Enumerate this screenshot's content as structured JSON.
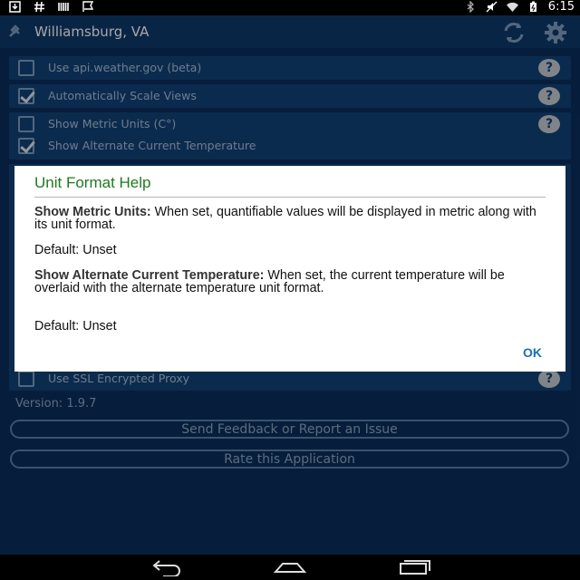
{
  "status_bar": {
    "time": "6:15"
  },
  "app": {
    "location": "Williamsburg, VA"
  },
  "settings": {
    "rows": [
      {
        "label": "Use api.weather.gov (beta)",
        "checked": false
      },
      {
        "label": "Automatically Scale Views",
        "checked": true
      },
      {
        "label": "Show Metric Units (C°)",
        "checked": false
      },
      {
        "label": "Show Alternate Current Temperature",
        "checked": true
      },
      {
        "label": "Use SSL Encrypted Proxy",
        "checked": false
      }
    ],
    "help_glyph": "?"
  },
  "version": "Version: 1.9.7",
  "buttons": {
    "feedback": "Send Feedback or Report an Issue",
    "rate": "Rate this Application"
  },
  "dialog": {
    "title": "Unit Format Help",
    "metric_heading": "Show Metric Units:",
    "metric_text": " When set, quantifiable values will be displayed in metric along with its unit format.",
    "metric_default": "Default: Unset",
    "alt_heading": "Show Alternate Current Temperature:",
    "alt_text": " When set, the current temperature will be overlaid with the alternate temperature unit format.",
    "alt_default": "Default: Unset",
    "ok_label": "OK"
  },
  "colors": {
    "accent_green": "#1f7a1f",
    "ok_blue": "#1a6fb8",
    "background": "#0a2f5c"
  }
}
